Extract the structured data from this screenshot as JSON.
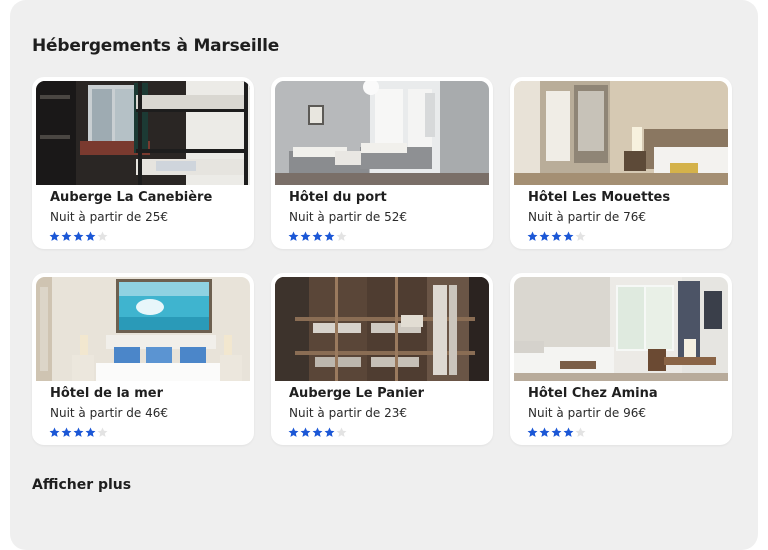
{
  "page": {
    "title": "Hébergements à Marseille",
    "more_label": "Afficher plus"
  },
  "colors": {
    "star_filled": "#1b57d6",
    "star_empty": "#e3e3e3",
    "panel": "#efefef"
  },
  "listings": [
    {
      "name": "Auberge La Canebière",
      "price": "Nuit à partir de 25€",
      "rating": 4,
      "max_rating": 5,
      "photo": "hostel-bunk-room-photo"
    },
    {
      "name": "Hôtel du port",
      "price": "Nuit à partir de 52€",
      "rating": 4,
      "max_rating": 5,
      "photo": "twin-room-photo"
    },
    {
      "name": "Hôtel Les Mouettes",
      "price": "Nuit à partir de 76€",
      "rating": 4,
      "max_rating": 5,
      "photo": "hotel-room-photo"
    },
    {
      "name": "Hôtel de la mer",
      "price": "Nuit à partir de 46€",
      "rating": 4,
      "max_rating": 5,
      "photo": "sea-painting-room-photo"
    },
    {
      "name": "Auberge Le Panier",
      "price": "Nuit à partir de 23€",
      "rating": 4,
      "max_rating": 5,
      "photo": "wooden-bunk-room-photo"
    },
    {
      "name": "Hôtel Chez Amina",
      "price": "Nuit à partir de 96€",
      "rating": 4,
      "max_rating": 5,
      "photo": "bright-room-photo"
    }
  ]
}
